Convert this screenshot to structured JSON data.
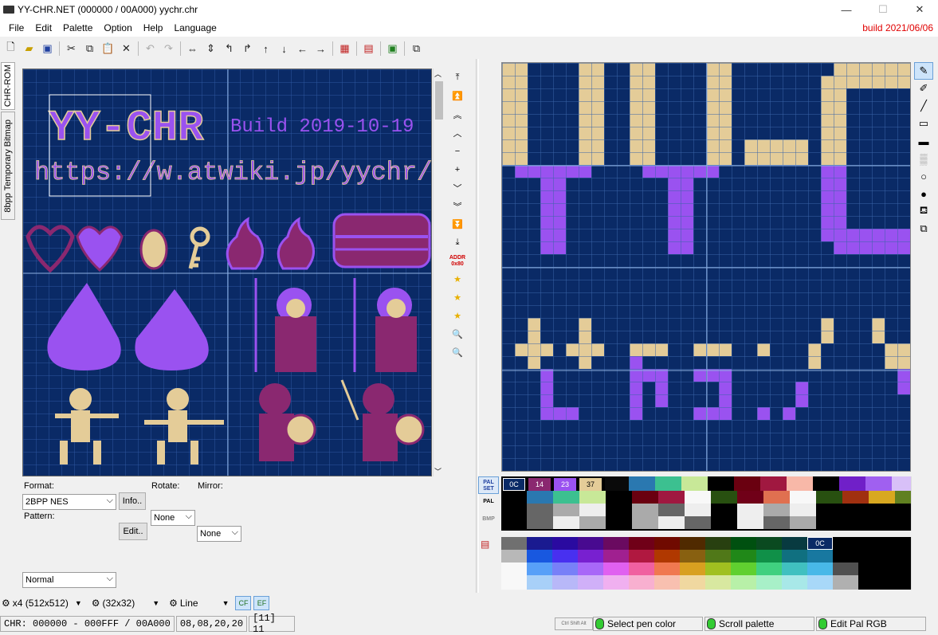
{
  "window": {
    "title": "YY-CHR.NET (000000 / 00A000) yychr.chr",
    "build": "build 2021/06/06",
    "minimize": "—",
    "maximize": "☐",
    "close": "✕"
  },
  "menu": [
    "File",
    "Edit",
    "Palette",
    "Option",
    "Help",
    "Language"
  ],
  "toolbar_icons": [
    "new-icon",
    "open-icon",
    "save-icon",
    "cut-icon",
    "copy-icon",
    "paste-icon",
    "delete-icon",
    "undo-icon",
    "redo-icon",
    "flip-horizontal-icon",
    "flip-vertical-icon",
    "rotate-left-icon",
    "rotate-right-icon",
    "shift-up-icon",
    "shift-down-icon",
    "shift-left-icon",
    "shift-right-icon",
    "palette-replace-icon",
    "palette-edit-icon",
    "save-palette-icon",
    "open-window-icon"
  ],
  "side_tabs": [
    "CHR-ROM",
    "8bpp Temporary Bitmap"
  ],
  "nav_addr": "ADDR 0x80",
  "format": {
    "label": "Format:",
    "value": "2BPP NES",
    "info_button": "Info.."
  },
  "rotate": {
    "label": "Rotate:",
    "value": "None"
  },
  "mirror": {
    "label": "Mirror:",
    "value": "None"
  },
  "pattern": {
    "label": "Pattern:",
    "value": "Normal",
    "edit_button": "Edit.."
  },
  "palette_tabs": [
    "PAL SET",
    "PAL",
    "BMP"
  ],
  "palette_selected": [
    "0C",
    "14",
    "23",
    "37"
  ],
  "nes_palette_label": "0C",
  "colors": {
    "bg": "#0a2a66",
    "grid": "#3a64a8",
    "tan": "#e4cc98",
    "purple": "#9a52f0",
    "magenta": "#8a2870",
    "accent_red": "#e00000"
  },
  "chr_text": {
    "title": "YY-CHR",
    "build": "Build 2019-10-19",
    "url": "https://w.atwiki.jp/yychr/"
  },
  "editor_text": {
    "line1": "YY-C",
    "line2": "ttps:/"
  },
  "bottom": {
    "zoom": "x4 (512x512)",
    "grid": "(32x32)",
    "line": "Line",
    "cf": "CF",
    "ef": "EF"
  },
  "status": {
    "chr": "CHR: 000000 - 000FFF / 00A000",
    "coords": "08,08,20,20",
    "tile": "[11] 11",
    "hint_keys": "Ctrl Shift Alt",
    "hint1": "Select pen color",
    "hint2": "Scroll palette",
    "hint3": "Edit Pal RGB"
  }
}
